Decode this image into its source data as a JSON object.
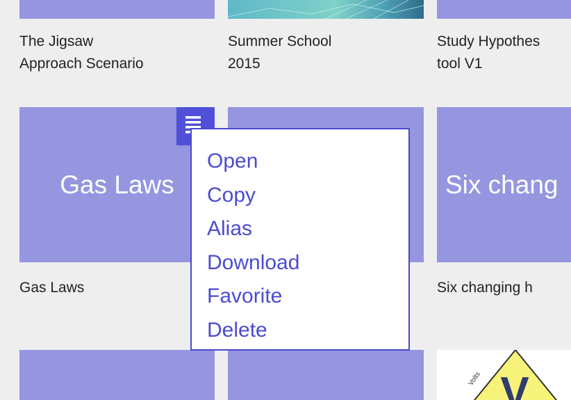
{
  "grid": {
    "row1": {
      "captions": [
        {
          "line1": "The Jigsaw",
          "line2": "Approach Scenario"
        },
        {
          "line1": "Summer School",
          "line2": "2015"
        },
        {
          "line1": "Study Hypothes",
          "line2": "tool V1"
        }
      ]
    },
    "row2": {
      "tiles": [
        {
          "title": "Gas Laws",
          "caption": "Gas Laws"
        },
        {
          "title": "",
          "caption": ""
        },
        {
          "title": "Six chang",
          "caption": "Six changing h"
        }
      ]
    },
    "row3": {
      "image_letter": "V",
      "image_small_text": "Volts"
    }
  },
  "context_menu": {
    "items": [
      "Open",
      "Copy",
      "Alias",
      "Download",
      "Favorite",
      "Delete"
    ]
  },
  "icons": {
    "menu_button": "document-lines-icon"
  },
  "colors": {
    "background": "#eeeeee",
    "tile": "#9595e0",
    "menu_button": "#5050d8",
    "menu_border": "#4848cc",
    "menu_text": "#4b4bd0",
    "caption_text": "#222222",
    "triangle_yellow": "#f7f27a"
  }
}
